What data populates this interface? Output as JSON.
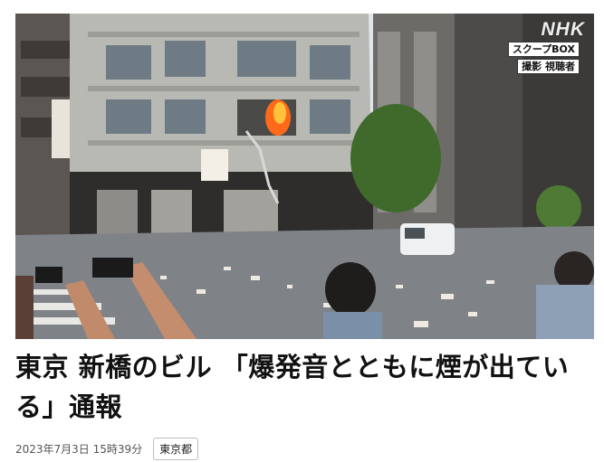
{
  "article": {
    "image_alt": "",
    "overlay": {
      "logo": "NHK",
      "caption_top": "スクープBOX",
      "caption_bottom": "撮影 視聴者"
    },
    "headline": "東京 新橋のビル 「爆発音とともに煙が出ている」通報",
    "timestamp": "2023年7月3日 15時39分",
    "tag": "東京都"
  },
  "colors": {
    "fire": "#ff6a1a",
    "building": "#b9b9b4",
    "sky": "#dfe5ea"
  }
}
